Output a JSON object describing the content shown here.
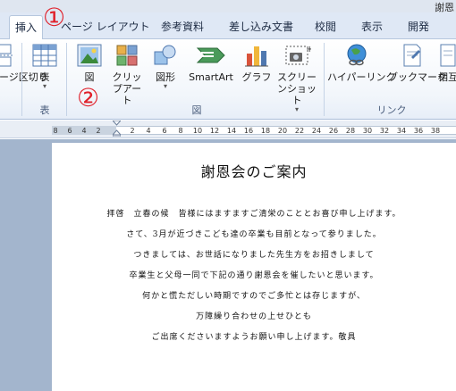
{
  "window": {
    "title": "謝恩"
  },
  "tabs": [
    {
      "label": "挿入"
    },
    {
      "label": "ページ レイアウト"
    },
    {
      "label": "参考資料"
    },
    {
      "label": "差し込み文書"
    },
    {
      "label": "校閲"
    },
    {
      "label": "表示"
    },
    {
      "label": "開発"
    }
  ],
  "ribbon": {
    "page_break_label": "ページ区切り",
    "table": {
      "label": "表",
      "group": "表"
    },
    "illustrations": {
      "picture": "図",
      "clipart": "クリップアート",
      "shapes": "図形",
      "smartart": "SmartArt",
      "chart": "グラフ",
      "screenshot": "スクリーンショット",
      "group": "図"
    },
    "links": {
      "hyperlink": "ハイパーリンク",
      "bookmark": "ブックマーク",
      "crossref": "相互",
      "group": "リンク"
    }
  },
  "ruler": {
    "ticks": [
      "8",
      "6",
      "4",
      "2",
      "2",
      "4",
      "6",
      "8",
      "10",
      "12",
      "14",
      "16",
      "18",
      "20",
      "22",
      "24",
      "26",
      "28",
      "30",
      "32",
      "34",
      "36",
      "38"
    ]
  },
  "annotations": {
    "step1": "①",
    "step2": "②"
  },
  "document": {
    "title": "謝恩会のご案内",
    "lines": [
      "拝啓　立春の候　皆様にはますますご清栄のこととお喜び申し上げます。",
      "さて、3月が近づきこども達の卒業も目前となって参りました。",
      "つきましては、お世話になりました先生方をお招きしまして",
      "卒業生と父母一同で下記の通り謝恩会を催したいと思います。",
      "何かと慌ただしい時期ですのでご多忙とは存じますが、",
      "万障繰り合わせの上せひとも",
      "ご出席くださいますようお願い申し上げます。敬具"
    ]
  }
}
